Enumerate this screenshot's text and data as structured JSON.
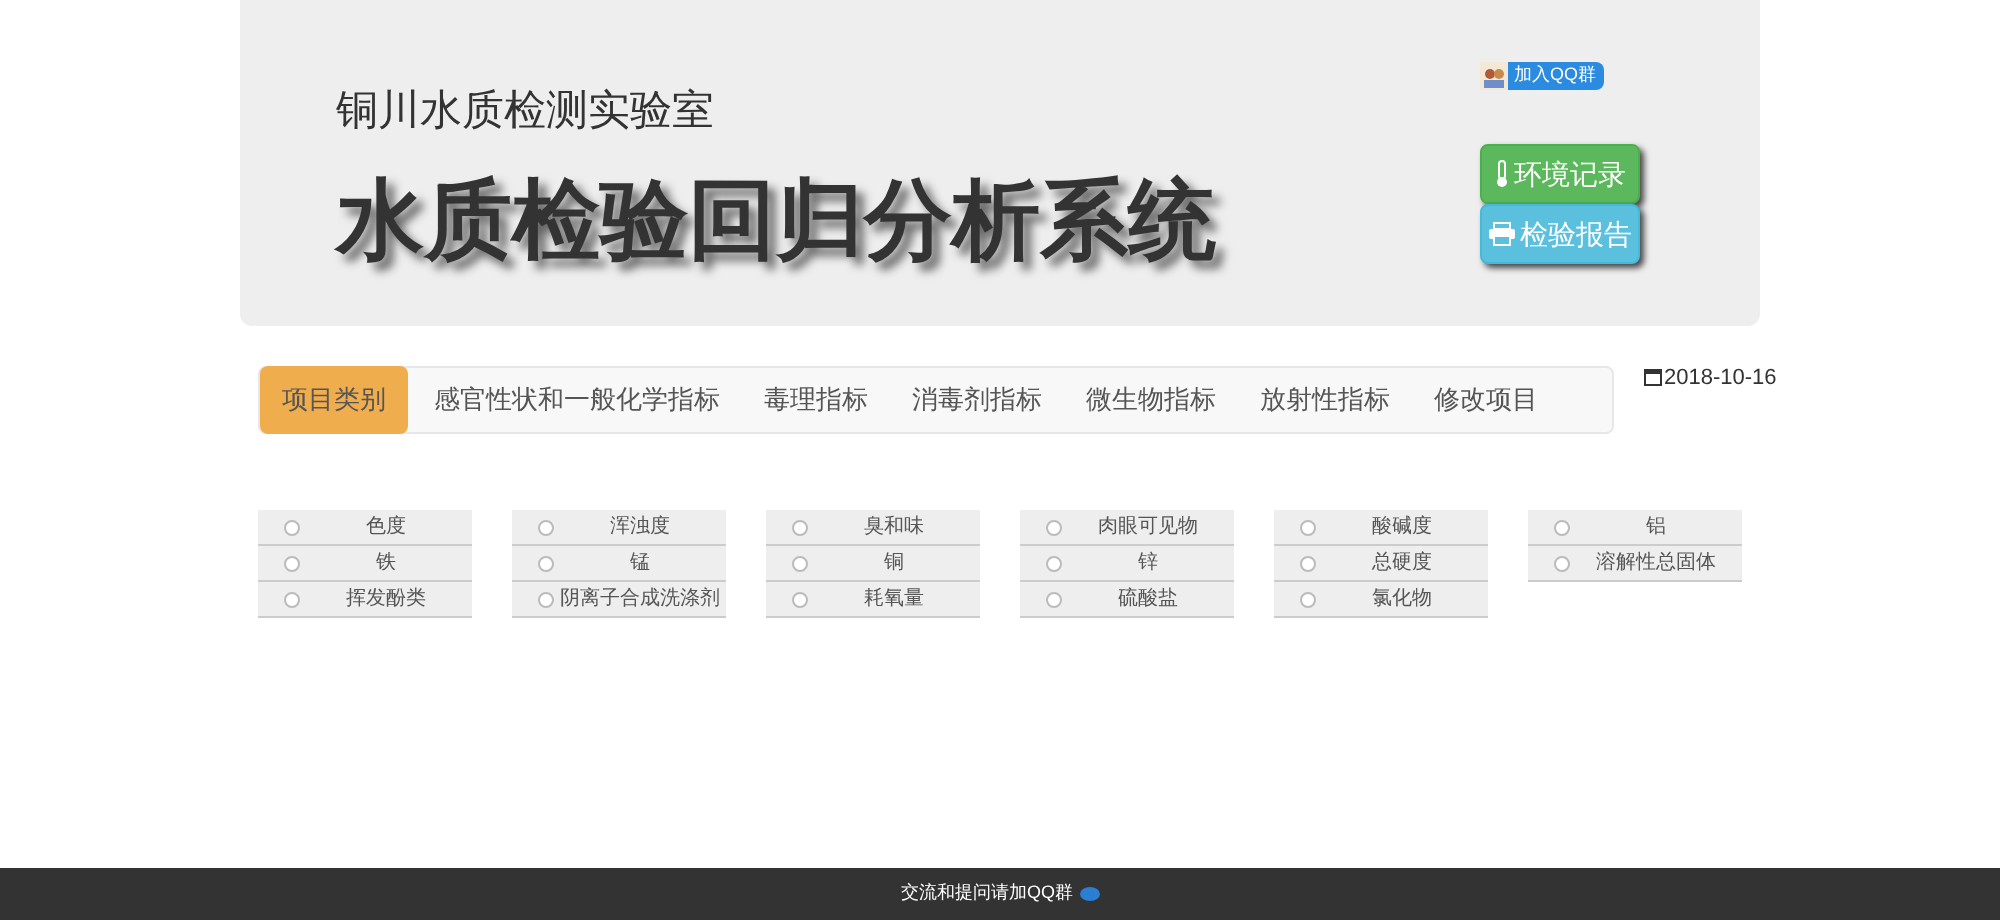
{
  "header": {
    "qq_badge": "加入QQ群",
    "subtitle": "铜川水质检测实验室",
    "title": "水质检验回归分析系统",
    "buttons": [
      {
        "kind": "env",
        "label": "环境记录"
      },
      {
        "kind": "report",
        "label": "检验报告"
      }
    ]
  },
  "tabs": [
    {
      "label": "项目类别",
      "selected": true
    },
    {
      "label": "感官性状和一般化学指标",
      "selected": false
    },
    {
      "label": "毒理指标",
      "selected": false
    },
    {
      "label": "消毒剂指标",
      "selected": false
    },
    {
      "label": "微生物指标",
      "selected": false
    },
    {
      "label": "放射性指标",
      "selected": false
    },
    {
      "label": "修改项目",
      "selected": false
    }
  ],
  "date": "2018-10-16",
  "columns": [
    [
      {
        "label": "色度",
        "selected": false
      },
      {
        "label": "铁",
        "selected": false
      },
      {
        "label": "挥发酚类",
        "selected": false
      }
    ],
    [
      {
        "label": "浑浊度",
        "selected": false
      },
      {
        "label": "锰",
        "selected": false
      },
      {
        "label": "阴离子合成洗涤剂",
        "selected": false
      }
    ],
    [
      {
        "label": "臭和味",
        "selected": false
      },
      {
        "label": "铜",
        "selected": false
      },
      {
        "label": "耗氧量",
        "selected": false
      }
    ],
    [
      {
        "label": "肉眼可见物",
        "selected": false
      },
      {
        "label": "锌",
        "selected": false
      },
      {
        "label": "硫酸盐",
        "selected": false
      }
    ],
    [
      {
        "label": "酸碱度",
        "selected": false
      },
      {
        "label": "总硬度",
        "selected": false
      },
      {
        "label": "氯化物",
        "selected": false
      }
    ],
    [
      {
        "label": "铝",
        "selected": false
      },
      {
        "label": "溶解性总固体",
        "selected": false
      }
    ]
  ],
  "footer": {
    "text": "交流和提问请加QQ群"
  }
}
